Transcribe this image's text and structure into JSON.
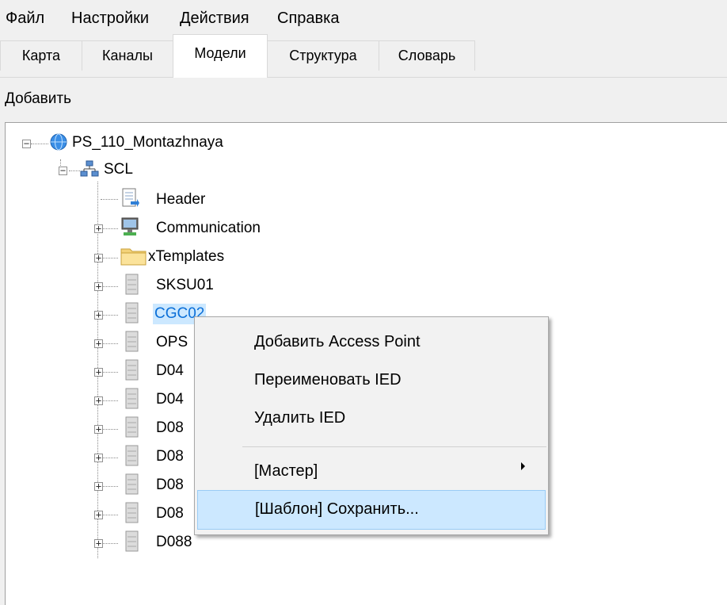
{
  "menu": [
    "Файл",
    "Настройки",
    "Действия",
    "Справка"
  ],
  "tabs": [
    "Карта",
    "Каналы",
    "Модели",
    "Структура",
    "Словарь"
  ],
  "toolbar": {
    "add_label": "Добавить"
  },
  "tree": {
    "root": "PS_110_Montazhnaya",
    "scl": "SCL",
    "children": [
      "Header",
      "Communication",
      "xTemplates",
      "SKSU01",
      "CGC02",
      "OPS",
      "D04",
      "D04",
      "D08",
      "D08",
      "D08",
      "D08",
      "D088"
    ]
  },
  "context_menu": {
    "add_access_point": "Добавить Access Point",
    "rename_ied": "Переименовать IED",
    "delete_ied": "Удалить IED",
    "master": "[Мастер]",
    "template_save": "[Шаблон] Сохранить..."
  }
}
